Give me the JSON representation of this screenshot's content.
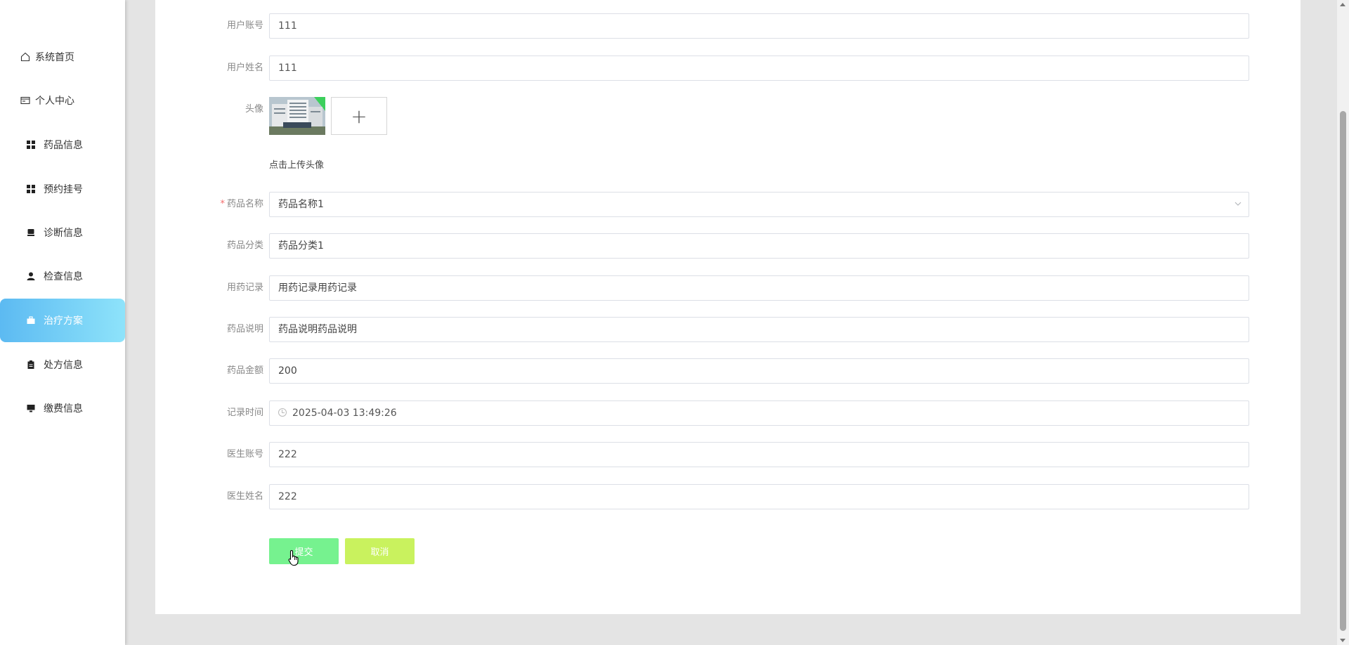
{
  "sidebar": {
    "items": [
      {
        "label": "系统首页",
        "icon": "home-icon"
      },
      {
        "label": "个人中心",
        "icon": "id-card-icon"
      },
      {
        "label": "药品信息",
        "icon": "grid-icon"
      },
      {
        "label": "预约挂号",
        "icon": "grid-icon"
      },
      {
        "label": "诊断信息",
        "icon": "chair-icon"
      },
      {
        "label": "检查信息",
        "icon": "user-icon"
      },
      {
        "label": "治疗方案",
        "icon": "briefcase-icon",
        "active": true
      },
      {
        "label": "处方信息",
        "icon": "clipboard-icon"
      },
      {
        "label": "缴费信息",
        "icon": "monitor-icon"
      }
    ],
    "active_gradient": [
      "#5cbaf2",
      "#8ee3fa"
    ]
  },
  "form": {
    "user_account": {
      "label": "用户账号",
      "value": "111"
    },
    "user_name": {
      "label": "用户姓名",
      "value": "111"
    },
    "avatar": {
      "label": "头像",
      "upload_hint": "点击上传头像",
      "add_symbol": "+"
    },
    "drug_name": {
      "label": "药品名称",
      "required_mark": "*",
      "value": "药品名称1"
    },
    "drug_category": {
      "label": "药品分类",
      "value": "药品分类1"
    },
    "medication_record": {
      "label": "用药记录",
      "value": "用药记录用药记录"
    },
    "drug_description": {
      "label": "药品说明",
      "value": "药品说明药品说明"
    },
    "drug_amount": {
      "label": "药品金额",
      "value": "200"
    },
    "record_time": {
      "label": "记录时间",
      "value": "2025-04-03 13:49:26"
    },
    "doctor_account": {
      "label": "医生账号",
      "value": "222"
    },
    "doctor_name": {
      "label": "医生姓名",
      "value": "222"
    }
  },
  "buttons": {
    "submit": "提交",
    "cancel": "取消",
    "submit_color": "#76f28f",
    "cancel_color": "#c9f25e"
  }
}
